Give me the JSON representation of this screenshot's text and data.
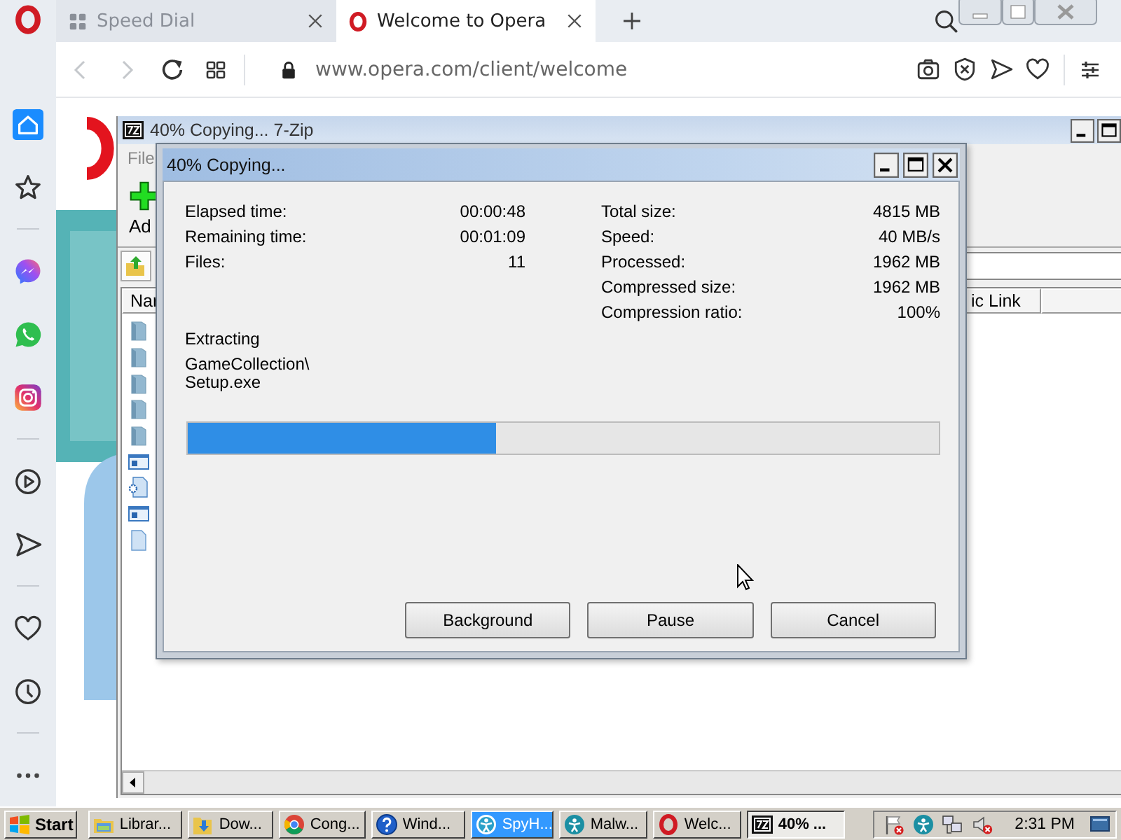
{
  "browser": {
    "tabs": [
      {
        "label": "Speed Dial",
        "kind": "speed_dial",
        "selected": false
      },
      {
        "label": "Welcome to Opera",
        "kind": "opera",
        "selected": true
      }
    ],
    "url": "www.opera.com/client/welcome",
    "sidebar": [
      {
        "kind": "home",
        "selected": true
      },
      {
        "kind": "star",
        "selected": false
      },
      {
        "kind": "separator"
      },
      {
        "kind": "messenger",
        "selected": false
      },
      {
        "kind": "whatsapp",
        "selected": false
      },
      {
        "kind": "instagram",
        "selected": false
      },
      {
        "kind": "separator"
      },
      {
        "kind": "player",
        "selected": false
      },
      {
        "kind": "send",
        "selected": false
      },
      {
        "kind": "separator"
      },
      {
        "kind": "heart",
        "selected": false
      },
      {
        "kind": "history",
        "selected": false
      },
      {
        "kind": "separator"
      },
      {
        "kind": "more",
        "selected": false
      }
    ]
  },
  "zip_window": {
    "title": "40% Copying... 7-Zip",
    "menu": [
      "File"
    ],
    "toolbar": [
      "Ad"
    ],
    "columns": [
      "Nar",
      "ic Link"
    ],
    "rows": [
      {
        "kind": "folder"
      },
      {
        "kind": "folder"
      },
      {
        "kind": "folder"
      },
      {
        "kind": "folder"
      },
      {
        "kind": "folder"
      },
      {
        "kind": "program"
      },
      {
        "kind": "settings"
      },
      {
        "kind": "program"
      },
      {
        "kind": "file"
      }
    ]
  },
  "progress_dialog": {
    "title": "40% Copying...",
    "stats_left": [
      {
        "label": "Elapsed time:",
        "value": "00:00:48"
      },
      {
        "label": "Remaining time:",
        "value": "00:01:09"
      },
      {
        "label": "Files:",
        "value": "11"
      }
    ],
    "stats_right": [
      {
        "label": "Total size:",
        "value": "4815 MB"
      },
      {
        "label": "Speed:",
        "value": "40 MB/s"
      },
      {
        "label": "Processed:",
        "value": "1962 MB"
      },
      {
        "label": "Compressed size:",
        "value": "1962 MB"
      },
      {
        "label": "Compression ratio:",
        "value": "100%"
      }
    ],
    "status": "Extracting",
    "path": [
      "GameCollection\\",
      "Setup.exe"
    ],
    "progress": {
      "level": 0.41
    },
    "buttons": [
      "Background",
      "Pause",
      "Cancel"
    ]
  },
  "taskbar": {
    "start": "Start",
    "items": [
      {
        "label": "Librar...",
        "kind": "library",
        "selected": false,
        "highlighted": false
      },
      {
        "label": "Dow...",
        "kind": "downloads",
        "selected": false,
        "highlighted": false
      },
      {
        "label": "Cong...",
        "kind": "chrome",
        "selected": false,
        "highlighted": false
      },
      {
        "label": "Wind...",
        "kind": "help",
        "selected": false,
        "highlighted": false
      },
      {
        "label": "SpyH...",
        "kind": "spyhunter",
        "selected": false,
        "highlighted": true
      },
      {
        "label": "Malw...",
        "kind": "malwarebytes",
        "selected": false,
        "highlighted": false
      },
      {
        "label": "Welc...",
        "kind": "opera",
        "selected": false,
        "highlighted": false
      },
      {
        "label": "40% ...",
        "kind": "sevenzip",
        "selected": true,
        "highlighted": false
      }
    ],
    "tray": [
      {
        "kind": "flag_error"
      },
      {
        "kind": "malwarebytes"
      },
      {
        "kind": "network"
      },
      {
        "kind": "speaker_muted"
      }
    ],
    "clock": "2:31 PM"
  }
}
